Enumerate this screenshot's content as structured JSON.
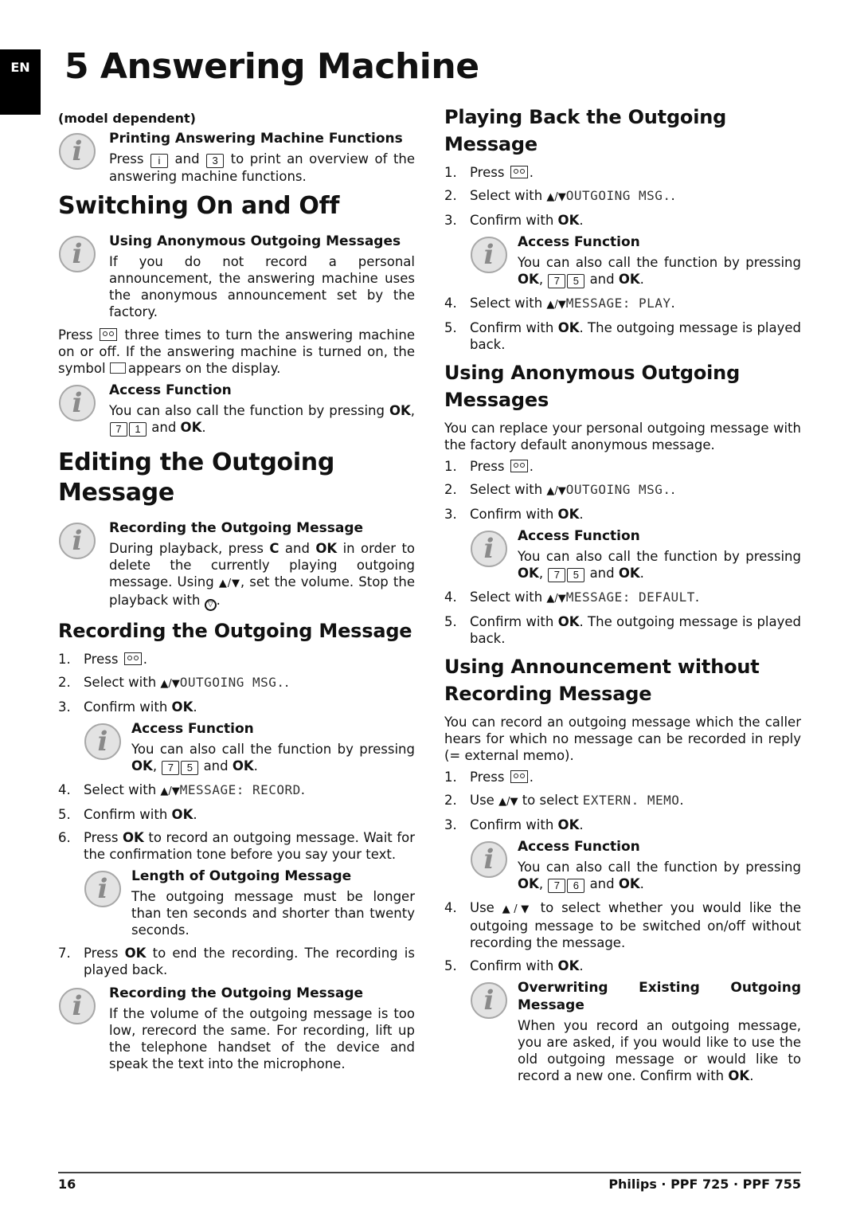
{
  "lang_tab": "EN",
  "chapter_title": "5 Answering Machine",
  "left": {
    "model_dependent": "(model dependent)",
    "note_print": {
      "title": "Printing Answering Machine Functions",
      "pre": "Press",
      "key1": "i",
      "mid": "and",
      "key2": "3",
      "post": "to print an overview of the answering machine functions."
    },
    "switching": {
      "heading": "Switching On and Off",
      "note_anon": {
        "title": "Using Anonymous Outgoing Messages",
        "body": "If you do not record a personal announcement, the answering machine uses the anonymous announcement set by the factory."
      },
      "para_pre": "Press",
      "para_mid": "three times to turn the answering machine on or off. If the answering machine is turned on, the symbol",
      "para_post": "appears on the display.",
      "note_access": {
        "title": "Access Function",
        "body_pre": "You can also call the function by pressing",
        "ok": "OK",
        "key1": "7",
        "key2": "1",
        "and": "and"
      }
    },
    "editing": {
      "heading": "Editing the Outgoing Message",
      "note_rec": {
        "title": "Recording the Outgoing Message",
        "b1": "During playback, press",
        "c": "C",
        "and": "and",
        "ok": "OK",
        "b2": "in order to delete the currently playing outgoing message. Using",
        "arrows": "▲/▼",
        "b3": ", set the volume. Stop the playback with",
        "stop": "▽",
        "end": "."
      }
    },
    "recording": {
      "heading": "Recording the Outgoing Message",
      "steps": [
        {
          "num": "1.",
          "text": "Press",
          "end": "."
        },
        {
          "num": "2.",
          "text": "Select with",
          "arrows": "▲/▼",
          "lcd": "OUTGOING MSG.",
          "end": "."
        },
        {
          "num": "3.",
          "text": "Confirm with",
          "bold": "OK",
          "end": "."
        },
        {
          "num": "4.",
          "text": "Select with",
          "arrows": "▲/▼",
          "lcd": "MESSAGE: RECORD",
          "end": "."
        },
        {
          "num": "5.",
          "text": "Confirm with",
          "bold": "OK",
          "end": "."
        },
        {
          "num": "6.",
          "pre": "Press",
          "bold": "OK",
          "text": "to record an outgoing message. Wait for the confirmation tone before you say your text."
        },
        {
          "num": "7.",
          "pre": "Press",
          "bold": "OK",
          "text": "to end the recording. The recording is played back."
        }
      ],
      "note_access": {
        "title": "Access Function",
        "body_pre": "You can also call the function by pressing",
        "ok": "OK",
        "key1": "7",
        "key2": "5",
        "and": "and"
      },
      "note_length": {
        "title": "Length of Outgoing Message",
        "body": "The outgoing message must be longer than ten seconds and shorter than twenty seconds."
      },
      "note_volume": {
        "title": "Recording the Outgoing Message",
        "body": "If the volume of the outgoing message is too low, rerecord the same. For recording, lift up the telephone handset of the device and speak the text into the microphone."
      }
    }
  },
  "right": {
    "playing": {
      "heading": "Playing Back the Outgoing Message",
      "steps": [
        {
          "num": "1.",
          "text": "Press",
          "end": "."
        },
        {
          "num": "2.",
          "text": "Select with",
          "arrows": "▲/▼",
          "lcd": "OUTGOING MSG.",
          "end": "."
        },
        {
          "num": "3.",
          "text": "Confirm with",
          "bold": "OK",
          "end": "."
        },
        {
          "num": "4.",
          "text": "Select with",
          "arrows": "▲/▼",
          "lcd": "MESSAGE: PLAY",
          "end": "."
        },
        {
          "num": "5.",
          "text": "Confirm with",
          "bold": "OK",
          "post": ". The outgoing message is played back."
        }
      ],
      "note_access": {
        "title": "Access Function",
        "body_pre": "You can also call the function by pressing",
        "ok": "OK",
        "key1": "7",
        "key2": "5",
        "and": "and"
      }
    },
    "anonymous": {
      "heading": "Using Anonymous Outgoing Messages",
      "intro": "You can replace your personal outgoing message with the factory default anonymous message.",
      "steps": [
        {
          "num": "1.",
          "text": "Press",
          "end": "."
        },
        {
          "num": "2.",
          "text": "Select with",
          "arrows": "▲/▼",
          "lcd": "OUTGOING MSG.",
          "end": "."
        },
        {
          "num": "3.",
          "text": "Confirm with",
          "bold": "OK",
          "end": "."
        },
        {
          "num": "4.",
          "text": "Select with",
          "arrows": "▲/▼",
          "lcd": "MESSAGE: DEFAULT",
          "end": "."
        },
        {
          "num": "5.",
          "text": "Confirm with",
          "bold": "OK",
          "post": ". The outgoing message is played back."
        }
      ],
      "note_access": {
        "title": "Access Function",
        "body_pre": "You can also call the function by pressing",
        "ok": "OK",
        "key1": "7",
        "key2": "5",
        "and": "and"
      }
    },
    "announcement": {
      "heading": "Using Announcement without Recording Message",
      "intro": "You can record an outgoing message which the caller hears for which no message can be recorded in reply (= external memo).",
      "steps": [
        {
          "num": "1.",
          "text": "Press",
          "end": "."
        },
        {
          "num": "2.",
          "text": "Use",
          "arrows": "▲/▼",
          "mid": "to select",
          "lcd": "EXTERN. MEMO",
          "end": "."
        },
        {
          "num": "3.",
          "text": "Confirm with",
          "bold": "OK",
          "end": "."
        },
        {
          "num": "4.",
          "text": "Use",
          "arrows": "▲/▼",
          "post": "to select whether you would like the outgoing message to be switched on/off without recording the message."
        },
        {
          "num": "5.",
          "text": "Confirm with",
          "bold": "OK",
          "end": "."
        }
      ],
      "note_access": {
        "title": "Access Function",
        "body_pre": "You can also call the function by pressing",
        "ok": "OK",
        "key1": "7",
        "key2": "6",
        "and": "and"
      },
      "note_overwrite": {
        "title": "Overwriting Existing Outgoing Message",
        "body": "When you record an outgoing message, you are asked, if you would like to use the old outgoing message or would like to record a new one. Confirm with",
        "ok": "OK",
        "end": "."
      }
    }
  },
  "footer": {
    "page": "16",
    "brand": "Philips · PPF 725 · PPF 755"
  }
}
